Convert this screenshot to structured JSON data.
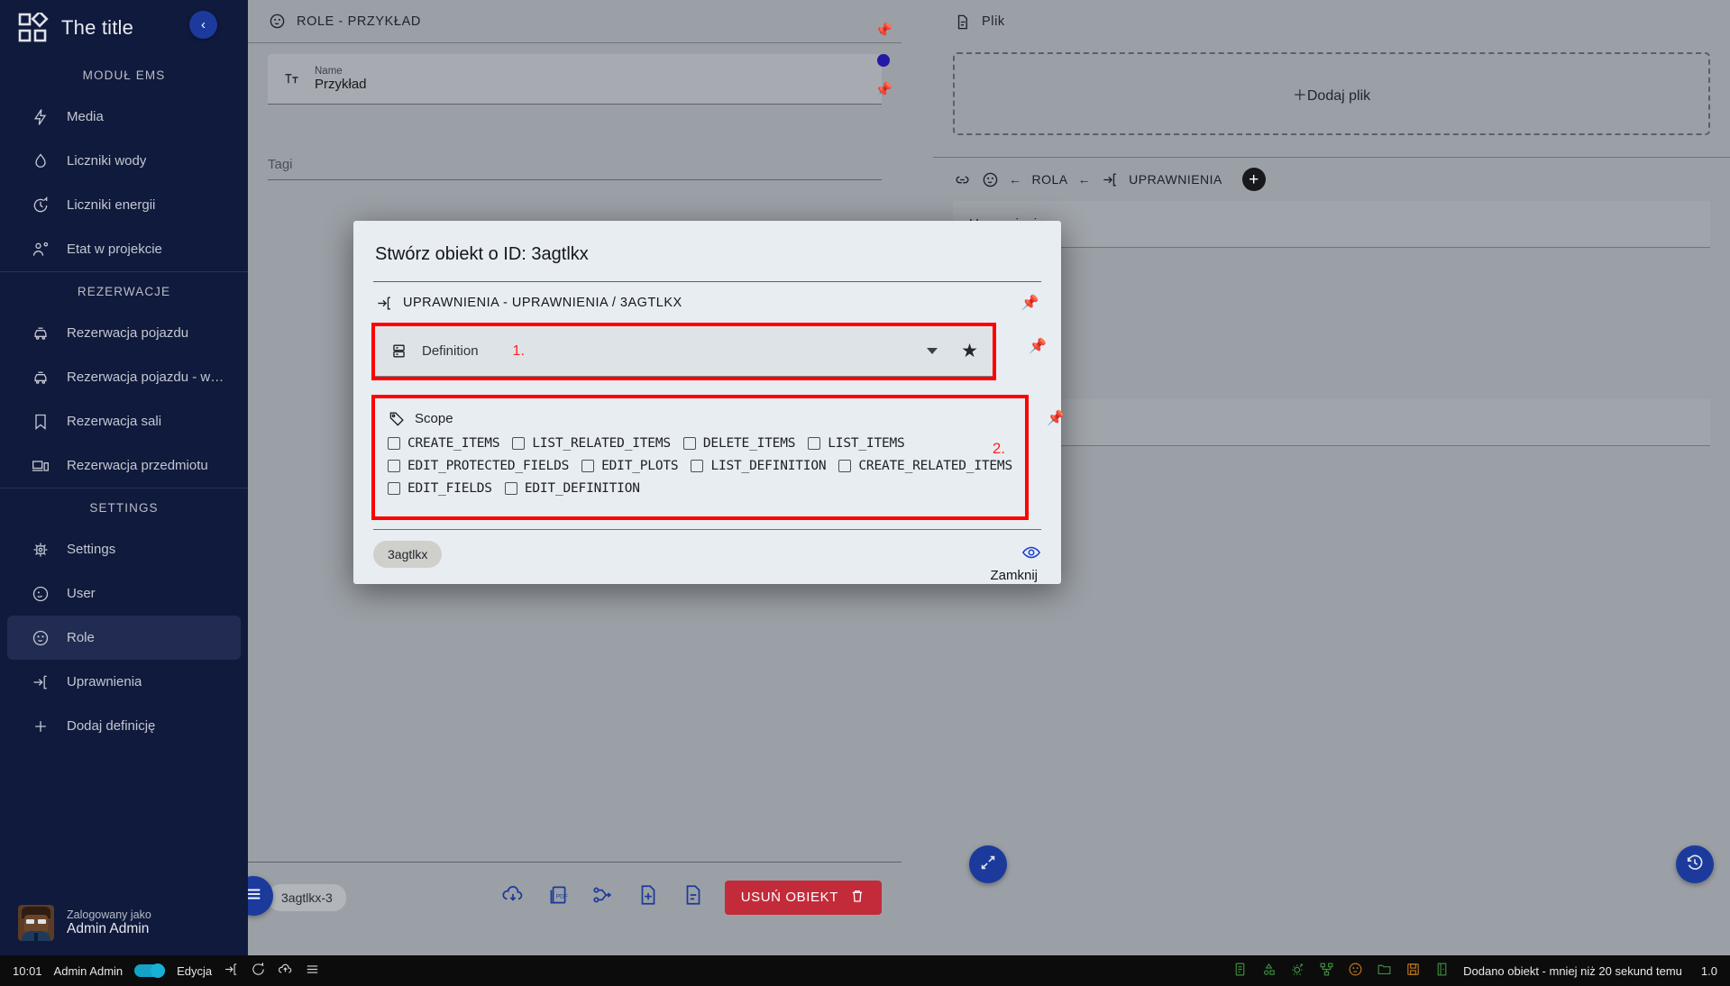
{
  "app": {
    "title": "The title",
    "logo_icon": "grid-diamond-logo"
  },
  "sidebar": {
    "collapse_icon": "chevron-left-icon",
    "groups": [
      {
        "label": "MODUŁ EMS",
        "items": [
          {
            "label": "Media",
            "icon": "bolt-icon"
          },
          {
            "label": "Liczniki wody",
            "icon": "water-drop-icon"
          },
          {
            "label": "Liczniki energii",
            "icon": "clock-refresh-icon"
          },
          {
            "label": "Etat w projekcie",
            "icon": "user-gear-icon"
          }
        ]
      },
      {
        "label": "REZERWACJE",
        "items": [
          {
            "label": "Rezerwacja pojazdu",
            "icon": "car-icon"
          },
          {
            "label": "Rezerwacja pojazdu - wni…",
            "icon": "car-icon"
          },
          {
            "label": "Rezerwacja sali",
            "icon": "bookmark-icon"
          },
          {
            "label": "Rezerwacja przedmiotu",
            "icon": "devices-icon"
          }
        ]
      },
      {
        "label": "SETTINGS",
        "items": [
          {
            "label": "Settings",
            "icon": "gear-chip-icon"
          },
          {
            "label": "User",
            "icon": "user-circle-icon"
          },
          {
            "label": "Role",
            "icon": "role-mask-icon",
            "active": true
          },
          {
            "label": "Uprawnienia",
            "icon": "login-arrow-icon"
          },
          {
            "label": "Dodaj definicję",
            "icon": "plus-icon"
          }
        ]
      }
    ],
    "user": {
      "caption": "Zalogowany jako",
      "name": "Admin Admin",
      "avatar_icon": "user-avatar"
    }
  },
  "left_panel": {
    "header_title": "ROLE - PRZYKŁAD",
    "header_icon": "role-mask-icon",
    "pin_icon": "pin-icon",
    "name_field": {
      "icon": "text-format-icon",
      "label": "Name",
      "value": "Przykład"
    },
    "tags_label": "Tagi",
    "bottom": {
      "chip": "3agtlkx-3",
      "menu_icon": "hamburger-icon",
      "icons": [
        "cloud-download-icon",
        "pdf-file-icon",
        "branch-merge-icon",
        "file-add-icon",
        "file-text-icon"
      ],
      "delete_label": "USUŃ OBIEKT",
      "delete_icon": "trash-icon"
    }
  },
  "right_panel": {
    "file_section": {
      "icon": "file-icon",
      "title": "Plik",
      "dropzone_label": "＋Dodaj plik"
    },
    "breadcrumb": {
      "icons": [
        "link-icon",
        "role-mask-icon"
      ],
      "parts": [
        "ROLA",
        "UPRAWNIENIA"
      ],
      "arrow": "←",
      "target_icon": "login-arrow-icon",
      "add_icon": "plus-circle-icon"
    },
    "rows": [
      "Uprawnienia"
    ],
    "fab_expand_icon": "expand-arrows-icon",
    "fab_history_icon": "history-icon"
  },
  "modal": {
    "title": "Stwórz obiekt o ID: 3agtlkx",
    "breadcrumb": {
      "icon": "login-arrow-icon",
      "text": "UPRAWNIENIA - UPRAWNIENIA / 3AGTLKX",
      "pin_icon": "pin-icon"
    },
    "definition": {
      "icon": "definition-icon",
      "label": "Definition",
      "marker": "1.",
      "value": "",
      "dropdown_icon": "caret-down-icon",
      "star_icon": "star-icon",
      "pin_icon": "pin-icon"
    },
    "scope": {
      "icon": "tag-icon",
      "label": "Scope",
      "marker": "2.",
      "pin_icon": "pin-icon",
      "rows": [
        [
          "CREATE_ITEMS",
          "LIST_RELATED_ITEMS",
          "DELETE_ITEMS",
          "LIST_ITEMS"
        ],
        [
          "EDIT_PROTECTED_FIELDS",
          "EDIT_PLOTS",
          "LIST_DEFINITION",
          "CREATE_RELATED_ITEMS"
        ],
        [
          "EDIT_FIELDS",
          "EDIT_DEFINITION"
        ]
      ]
    },
    "chip_id": "3agtlkx",
    "eye_icon": "eye-icon",
    "close_label": "Zamknij",
    "highlight_color": "#ff0000"
  },
  "statusbar": {
    "time": "10:01",
    "user": "Admin Admin",
    "mode_label": "Edycja",
    "left_icons": [
      "login-arrow-icon",
      "refresh-icon",
      "cloud-upload-icon",
      "menu-icon"
    ],
    "right_icons": [
      "report-icon",
      "shapes-icon",
      "gear-plus-icon",
      "sitemap-icon",
      "role-mask-icon",
      "folder-icon",
      "save-icon",
      "door-exit-icon"
    ],
    "message": "Dodano obiekt - mniej niż 20 sekund temu",
    "version": "1.0"
  }
}
